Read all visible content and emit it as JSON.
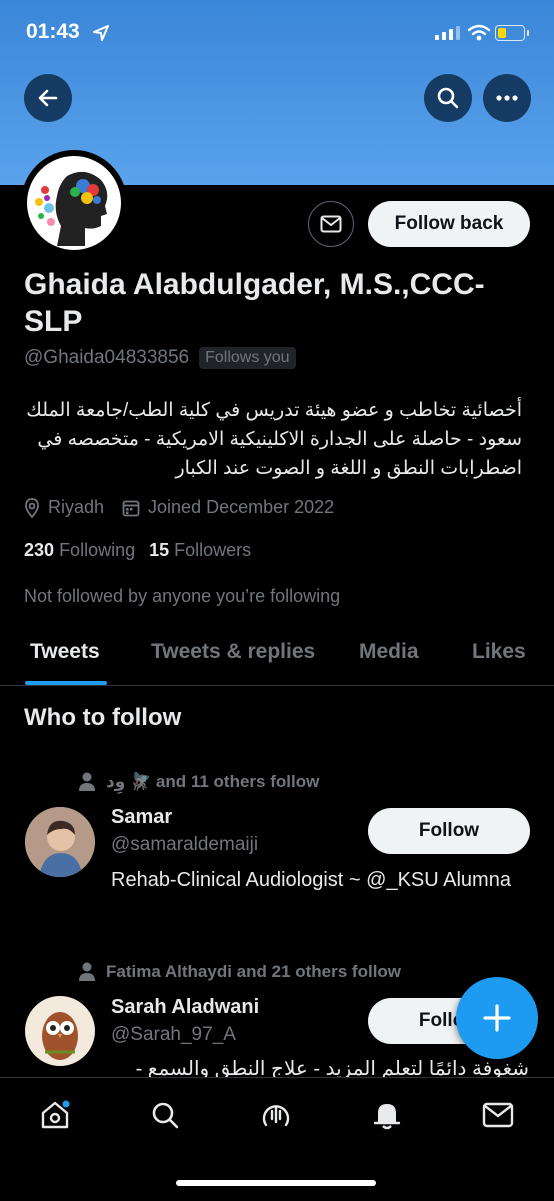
{
  "status_bar": {
    "time": "01:43"
  },
  "profile": {
    "name": "Ghaida Alabdulgader, M.S.,CCC-SLP",
    "handle": "@Ghaida04833856",
    "follows_you": "Follows you",
    "bio": "أخصائية تخاطب و عضو هيئة تدريس في كلية الطب/جامعة الملك سعود - حاصلة على الجدارة الاكلينيكية الامريكية - متخصصه في اضطرابات النطق و اللغة و الصوت عند الكبار",
    "location": "Riyadh",
    "joined": "Joined December 2022",
    "following_count": "230",
    "following_label": "Following",
    "followers_count": "15",
    "followers_label": "Followers",
    "not_followed": "Not followed by anyone you’re following",
    "follow_back_label": "Follow back"
  },
  "tabs": [
    "Tweets",
    "Tweets & replies",
    "Media",
    "Likes"
  ],
  "who_to_follow": {
    "title": "Who to follow",
    "users": [
      {
        "social_context": "‏وِد 🪰 and 11 others follow",
        "name": "Samar",
        "handle": "@samaraldemaiji",
        "bio": "Rehab-Clinical Audiologist ~ @_KSU Alumna",
        "follow_label": "Follow"
      },
      {
        "social_context": "Fatima Althaydi and 21 others follow",
        "name": "Sarah Aladwani",
        "handle": "@Sarah_97_A",
        "bio": "شغوفة دائمًا لتعلم المزيد - علاج النطق والسمع -",
        "follow_label": "Follow"
      }
    ]
  },
  "icons": {
    "back": "back-arrow-icon",
    "search": "search-icon",
    "more": "more-icon",
    "mail": "mail-icon",
    "location": "location-pin-icon",
    "calendar": "calendar-icon",
    "person": "person-icon",
    "compose": "plus-icon",
    "home": "home-icon",
    "explore": "search-icon",
    "spaces": "spaces-icon",
    "notifications": "bell-icon",
    "messages": "mail-icon"
  },
  "colors": {
    "accent": "#1d9bf0",
    "banner": "#4a94e2",
    "muted": "#71767b"
  }
}
